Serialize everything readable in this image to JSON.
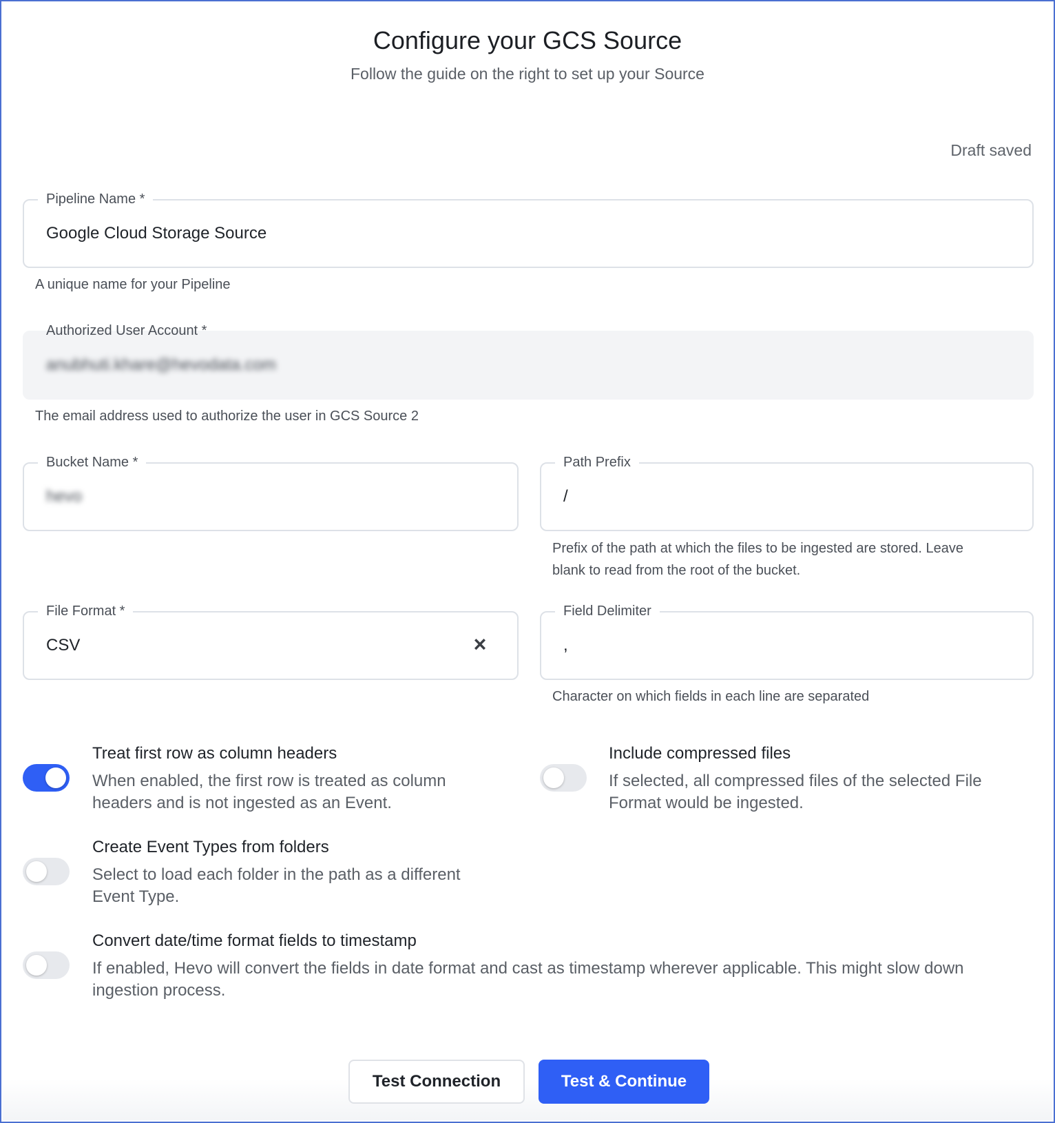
{
  "header": {
    "title": "Configure your GCS Source",
    "subtitle": "Follow the guide on the right to set up your Source",
    "draft_status": "Draft saved"
  },
  "fields": {
    "pipeline_name": {
      "label": "Pipeline Name *",
      "value": "Google Cloud Storage Source",
      "hint": "A unique name for your Pipeline"
    },
    "authorized_user": {
      "label": "Authorized User Account *",
      "value": "anubhuti.khare@hevodata.com",
      "hint": "The email address used to authorize the user in GCS Source 2"
    },
    "bucket_name": {
      "label": "Bucket Name *",
      "value": "hevo"
    },
    "path_prefix": {
      "label": "Path Prefix",
      "value": "/",
      "hint_line1": "Prefix of the path at which the files to be ingested are stored. Leave",
      "hint_line2": "blank to read from the root of the bucket."
    },
    "file_format": {
      "label": "File Format *",
      "value": "CSV",
      "clear_icon": "×"
    },
    "field_delimiter": {
      "label": "Field Delimiter",
      "value": ",",
      "hint": "Character on which fields in each line are separated"
    }
  },
  "options": {
    "first_row_headers": {
      "title": "Treat first row as column headers",
      "desc_line1": "When enabled, the first row is treated as column",
      "desc_line2": "headers and is not ingested as an Event.",
      "enabled": true
    },
    "compressed_files": {
      "title": "Include compressed files",
      "desc_line1": "If selected, all compressed files of the selected File",
      "desc_line2": "Format would be ingested.",
      "enabled": false
    },
    "event_types_folders": {
      "title": "Create Event Types from folders",
      "desc_line1": "Select to load each folder in the path as a different",
      "desc_line2": "Event Type.",
      "enabled": false
    },
    "convert_datetime": {
      "title": "Convert date/time format fields to timestamp",
      "desc_line1": "If enabled, Hevo will convert the fields in date format and cast as timestamp wherever applicable. This might slow down",
      "desc_line2": "ingestion process.",
      "enabled": false
    }
  },
  "actions": {
    "test_connection": "Test Connection",
    "test_continue": "Test & Continue"
  },
  "colors": {
    "primary": "#2f5ff5",
    "frame_border": "#4a6fd1"
  }
}
